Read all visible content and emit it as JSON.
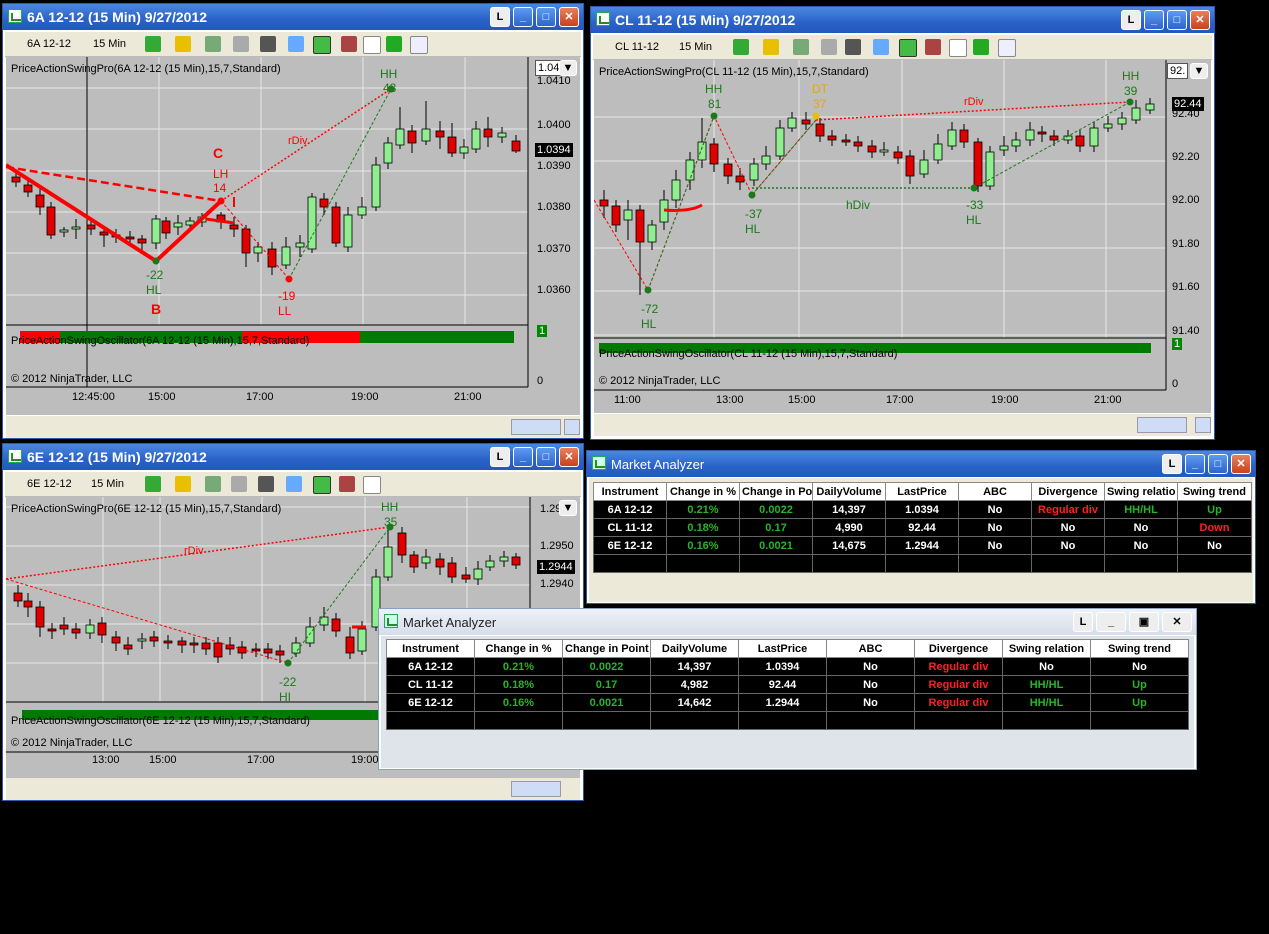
{
  "windows": {
    "w6a": {
      "title": "6A 12-12 (15 Min)  9/27/2012",
      "instrument": "6A 12-12",
      "interval": "15 Min",
      "indicator": "PriceActionSwingPro(6A 12-12 (15 Min),15,7,Standard)",
      "oscillator": "PriceActionSwingOscillator(6A 12-12 (15 Min),15,7,Standard)",
      "copyright": "© 2012 NinjaTrader, LLC",
      "price_labels": [
        "1.0410",
        "1.0400",
        "1.0390",
        "1.0380",
        "1.0370",
        "1.0360"
      ],
      "top_price": "1.04",
      "last_price": "1.0394",
      "osc_zero": "0",
      "osc_one": "1",
      "time_labels": [
        "12:45:00",
        "15:00",
        "17:00",
        "19:00",
        "21:00"
      ],
      "annotations": {
        "hh": "HH",
        "hh_val": "43",
        "rdiv": "rDiv",
        "c": "C",
        "lh": "LH",
        "lh_val": "14",
        "hl_val": "-22",
        "hl": "HL",
        "b": "B",
        "ll_val": "-19",
        "ll": "LL"
      }
    },
    "wcl": {
      "title": "CL 11-12 (15 Min)  9/27/2012",
      "instrument": "CL 11-12",
      "interval": "15 Min",
      "indicator": "PriceActionSwingPro(CL 11-12 (15 Min),15,7,Standard)",
      "oscillator": "PriceActionSwingOscillator(CL 11-12 (15 Min),15,7,Standard)",
      "copyright": "© 2012 NinjaTrader, LLC",
      "price_labels": [
        "92.40",
        "92.20",
        "92.00",
        "91.80",
        "91.60",
        "91.40"
      ],
      "top_price": "92.",
      "last_price": "92.44",
      "osc_zero": "0",
      "osc_one": "1",
      "time_labels": [
        "11:00",
        "13:00",
        "15:00",
        "17:00",
        "19:00",
        "21:00"
      ],
      "annotations": {
        "hh1": "HH",
        "hh1_val": "81",
        "dt": "DT",
        "dt_val": "37",
        "rdiv": "rDiv",
        "hh2": "HH",
        "hh2_val": "39",
        "hl1_val": "-37",
        "hl1": "HL",
        "hdiv": "hDiv",
        "hl2_val": "-33",
        "hl2": "HL",
        "hl3_val": "-72",
        "hl3": "HL"
      }
    },
    "w6e": {
      "title": "6E 12-12 (15 Min)  9/27/2012",
      "instrument": "6E 12-12",
      "interval": "15 Min",
      "indicator": "PriceActionSwingPro(6E 12-12 (15 Min),15,7,Standard)",
      "oscillator": "PriceActionSwingOscillator(6E 12-12 (15 Min),15,7,Standard)",
      "copyright": "© 2012 NinjaTrader, LLC",
      "price_labels": [
        "1.29",
        "1.2950",
        "1.2940"
      ],
      "last_price": "1.2944",
      "time_labels": [
        "13:00",
        "15:00",
        "17:00",
        "19:00"
      ],
      "annotations": {
        "hh": "HH",
        "hh_val": "35",
        "rdiv": "rDiv",
        "hl_val": "-22",
        "hl": "HI"
      }
    }
  },
  "analyzer1": {
    "title": "Market Analyzer",
    "headers": [
      "Instrument",
      "Change in %",
      "Change in Po",
      "DailyVolume",
      "LastPrice",
      "ABC",
      "Divergence",
      "Swing relatio",
      "Swing trend"
    ],
    "rows": [
      [
        "6A 12-12",
        "0.21%",
        "0.0022",
        "14,397",
        "1.0394",
        "No",
        "Regular div",
        "HH/HL",
        "Up"
      ],
      [
        "CL 11-12",
        "0.18%",
        "0.17",
        "4,990",
        "92.44",
        "No",
        "No",
        "No",
        "Down"
      ],
      [
        "6E 12-12",
        "0.16%",
        "0.0021",
        "14,675",
        "1.2944",
        "No",
        "No",
        "No",
        "No"
      ]
    ]
  },
  "analyzer2": {
    "title": "Market Analyzer",
    "headers": [
      "Instrument",
      "Change in %",
      "Change in Point",
      "DailyVolume",
      "LastPrice",
      "ABC",
      "Divergence",
      "Swing relation",
      "Swing trend"
    ],
    "rows": [
      [
        "6A 12-12",
        "0.21%",
        "0.0022",
        "14,397",
        "1.0394",
        "No",
        "Regular div",
        "No",
        "No"
      ],
      [
        "CL 11-12",
        "0.18%",
        "0.17",
        "4,982",
        "92.44",
        "No",
        "Regular div",
        "HH/HL",
        "Up"
      ],
      [
        "6E 12-12",
        "0.16%",
        "0.0021",
        "14,642",
        "1.2944",
        "No",
        "Regular div",
        "HH/HL",
        "Up"
      ]
    ]
  },
  "colors": {
    "up_candle": "#90ee90",
    "down_candle": "#e00000",
    "swing_green": "#1a7a1a",
    "swing_red": "#ff0000",
    "title_blue": "#2a62c8"
  }
}
